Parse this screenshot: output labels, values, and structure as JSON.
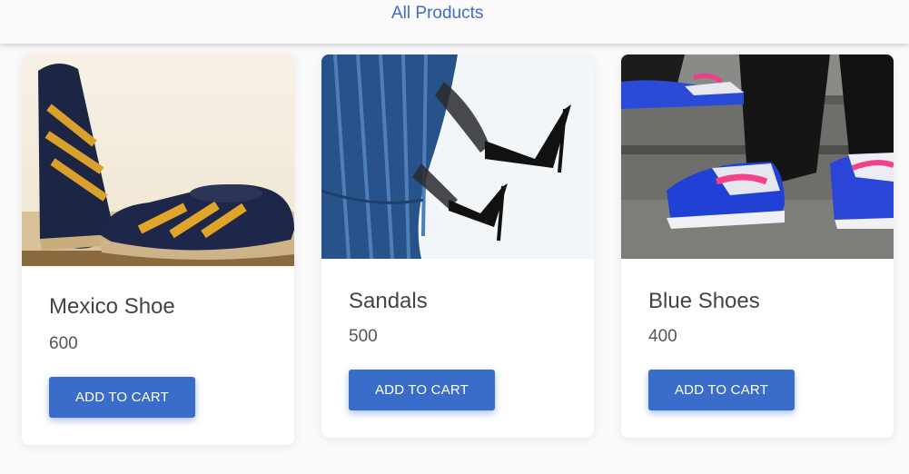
{
  "header": {
    "nav_link": "All Products"
  },
  "products": [
    {
      "name": "Mexico Shoe",
      "price": "600",
      "button": "ADD TO CART",
      "image_icon": "mexico-shoe-photo"
    },
    {
      "name": "Sandals",
      "price": "500",
      "button": "ADD TO CART",
      "image_icon": "sandals-photo"
    },
    {
      "name": "Blue Shoes",
      "price": "400",
      "button": "ADD TO CART",
      "image_icon": "blue-shoes-photo"
    }
  ],
  "colors": {
    "accent": "#3a6cc9",
    "link": "#3f6bc4",
    "background": "#fafafa"
  }
}
